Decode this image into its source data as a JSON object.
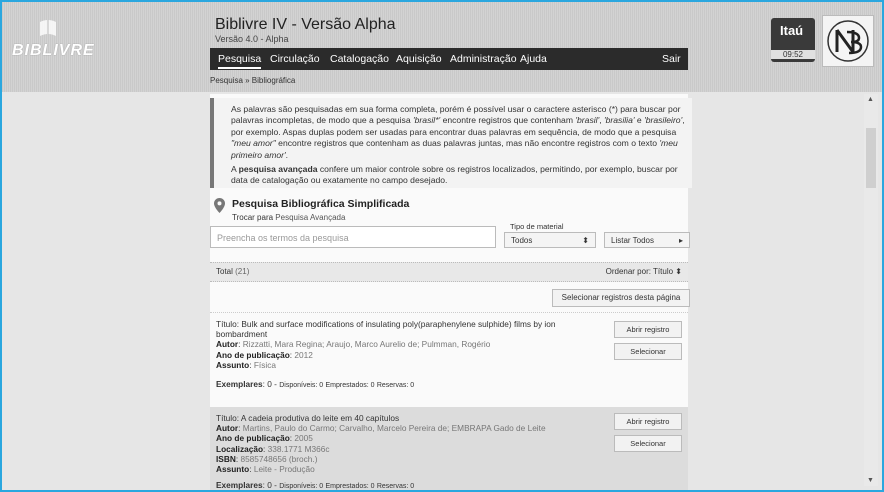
{
  "app": {
    "logo_text": "BIBLIVRE",
    "title": "Biblivre IV - Versão Alpha",
    "version": "Versão 4.0 - Alpha"
  },
  "menu": {
    "items": [
      "Pesquisa",
      "Circulação",
      "Catalogação",
      "Aquisição",
      "Administração",
      "Ajuda"
    ],
    "logout": "Sair"
  },
  "breadcrumb": "Pesquisa » Bibliográfica",
  "sponsor": {
    "brand": "Itaú",
    "time": "09:52"
  },
  "info": {
    "p1_a": "As palavras são pesquisadas em sua forma completa, porém é possível usar o caractere asterisco (*) para buscar por palavras incompletas, de modo que a pesquisa ",
    "p1_b": "'brasil*'",
    "p1_c": " encontre registros que contenham ",
    "p1_d": "'brasil'",
    "p1_e": ", ",
    "p1_f": "'brasilia'",
    "p1_g": " e ",
    "p1_h": "'brasileiro'",
    "p1_i": ", por exemplo. Aspas duplas podem ser usadas para encontrar duas palavras em sequência, de modo que a pesquisa ",
    "p1_j": "\"meu amor\"",
    "p1_k": " encontre registros que contenham as duas palavras juntas, mas não encontre registros com o texto ",
    "p1_l": "'meu primeiro amor'",
    "p1_m": ".",
    "p2_a": "A ",
    "p2_b": "pesquisa avançada",
    "p2_c": " confere um maior controle sobre os registros localizados, permitindo, por exemplo, buscar por data de catalogação ou exatamente no campo desejado."
  },
  "search": {
    "title": "Pesquisa Bibliográfica Simplificada",
    "switch_prefix": "Trocar para ",
    "switch_link": "Pesquisa Avançada",
    "placeholder": "Preencha os termos da pesquisa",
    "material_label": "Tipo de material",
    "material_value": "Todos",
    "list_all": "Listar Todos"
  },
  "results": {
    "total_label": "Total",
    "total_count": "(21)",
    "order_label": "Ordenar por:",
    "order_value": "Título",
    "select_page": "Selecionar registros desta página",
    "open_label": "Abrir registro",
    "select_label": "Selecionar",
    "records": [
      {
        "titulo_label": "Título",
        "titulo": "Bulk and surface modifications of insulating poly(paraphenylene sulphide) films by ion bombardment",
        "autor_label": "Autor",
        "autor": "Rizzatti, Mara Regina; Araujo, Marco Aurelio de; Pulmman, Rogério",
        "ano_label": "Ano de publicação",
        "ano": "2012",
        "assunto_label": "Assunto",
        "assunto": "Física",
        "exemplares_label": "Exemplares",
        "exemplares": "0",
        "disponiveis": "Disponíveis: 0",
        "emprestados": "Emprestados: 0",
        "reservas": "Reservas: 0"
      },
      {
        "titulo_label": "Título",
        "titulo": "A cadeia produtiva do leite em 40 capítulos",
        "autor_label": "Autor",
        "autor": "Martins, Paulo do Carmo; Carvalho, Marcelo Pereira de; EMBRAPA Gado de Leite",
        "ano_label": "Ano de publicação",
        "ano": "2005",
        "loc_label": "Localização",
        "loc": "338.1771 M366c",
        "isbn_label": "ISBN",
        "isbn": "8585748656 (broch.)",
        "assunto_label": "Assunto",
        "assunto": "Leite - Produção",
        "exemplares_label": "Exemplares",
        "exemplares": "0",
        "disponiveis": "Disponíveis: 0",
        "emprestados": "Emprestados: 0",
        "reservas": "Reservas: 0"
      }
    ]
  }
}
